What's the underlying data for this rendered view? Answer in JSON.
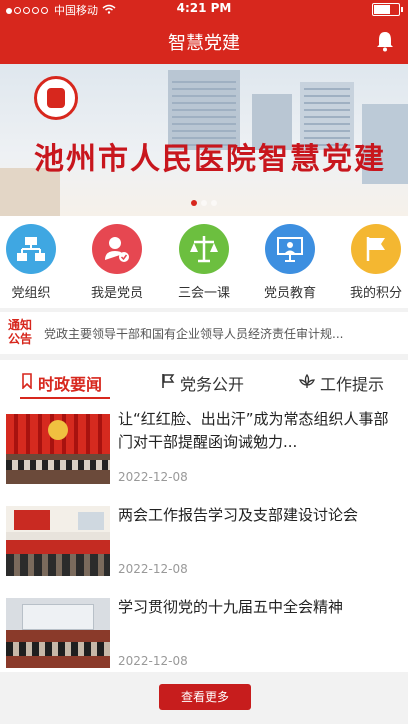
{
  "status_bar": {
    "carrier": "中国移动",
    "time": "4:21 PM"
  },
  "nav": {
    "title": "智慧党建",
    "notification_icon": "bell-icon"
  },
  "banner": {
    "slogan": "池州市人民医院智慧党建"
  },
  "quick_menu": [
    {
      "label": "党组织",
      "icon": "org-chart-icon",
      "color": "#3fa7e2"
    },
    {
      "label": "我是党员",
      "icon": "member-check-icon",
      "color": "#e64751"
    },
    {
      "label": "三会一课",
      "icon": "scales-icon",
      "color": "#6cbf3f"
    },
    {
      "label": "党员教育",
      "icon": "presentation-icon",
      "color": "#3d8fe0"
    },
    {
      "label": "我的积分",
      "icon": "flag-icon",
      "color": "#f4b731"
    }
  ],
  "notice": {
    "tag_line1": "通知",
    "tag_line2": "公告",
    "text": "党政主要领导干部和国有企业领导人员经济责任审计规..."
  },
  "tabs": [
    {
      "label": "时政要闻",
      "icon": "bookmark-icon"
    },
    {
      "label": "党务公开",
      "icon": "flag-outline-icon"
    },
    {
      "label": "工作提示",
      "icon": "lotus-icon"
    }
  ],
  "news": [
    {
      "title": "让“红红脸、出出汗”成为常态组织人事部门对干部提醒函询诫勉力...",
      "date": "2022-12-08"
    },
    {
      "title": "两会工作报告学习及支部建设讨论会",
      "date": "2022-12-08"
    },
    {
      "title": "学习贯彻党的十九届五中全会精神",
      "date": "2022-12-08"
    }
  ],
  "more_button": "查看更多",
  "colors": {
    "primary": "#d7271d"
  }
}
